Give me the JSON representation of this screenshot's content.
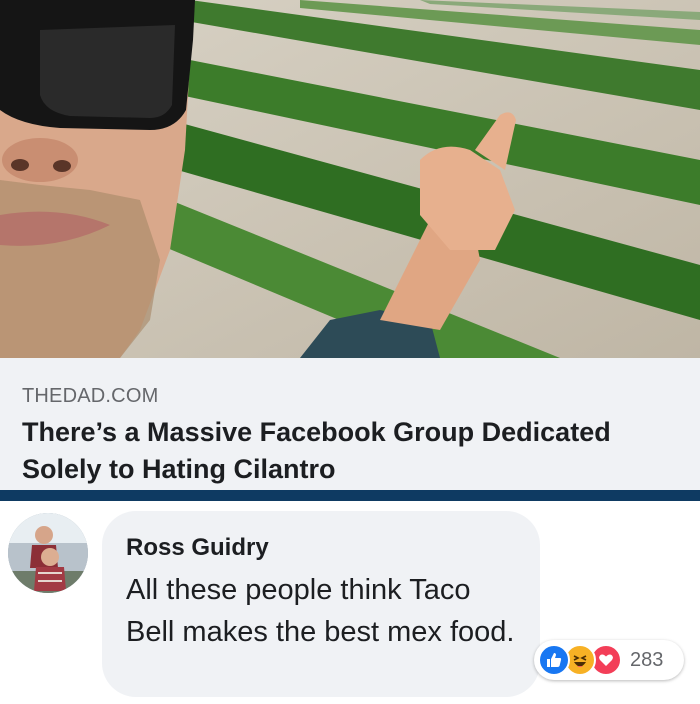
{
  "link_preview": {
    "domain": "THEDAD.COM",
    "title": "There’s a Massive Facebook Group Dedicated Solely to Hating Cilantro",
    "image_icon": "photo-man-in-cilantro-field"
  },
  "comment": {
    "author": "Ross Guidry",
    "text": "All these people think Taco Bell makes the best mex food.",
    "avatar_icon": "avatar-photo-two-children",
    "reactions": {
      "icons": [
        "like-icon",
        "haha-icon",
        "love-icon"
      ],
      "count": "283"
    }
  },
  "colors": {
    "link_rule": "#0e3a62",
    "like": "#1877f2",
    "haha": "#f7b125",
    "love": "#f33e58",
    "bubble": "#f0f2f5"
  }
}
